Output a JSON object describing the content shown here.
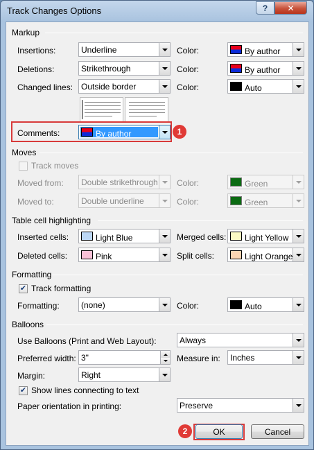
{
  "window": {
    "title": "Track Changes Options",
    "help_label": "?",
    "close_label": "✕"
  },
  "markup": {
    "section_label": "Markup",
    "insertions_label": "Insertions:",
    "insertions_value": "Underline",
    "insertions_color_label": "Color:",
    "insertions_color": "By author",
    "deletions_label": "Deletions:",
    "deletions_value": "Strikethrough",
    "deletions_color_label": "Color:",
    "deletions_color": "By author",
    "changed_lines_label": "Changed lines:",
    "changed_lines_value": "Outside border",
    "changed_lines_color_label": "Color:",
    "changed_lines_color": "Auto",
    "comments_label": "Comments:",
    "comments_color": "By author"
  },
  "moves": {
    "section_label": "Moves",
    "track_moves_label": "Track moves",
    "moved_from_label": "Moved from:",
    "moved_from_value": "Double strikethrough",
    "moved_from_color_label": "Color:",
    "moved_from_color": "Green",
    "moved_to_label": "Moved to:",
    "moved_to_value": "Double underline",
    "moved_to_color_label": "Color:",
    "moved_to_color": "Green"
  },
  "table_cells": {
    "section_label": "Table cell highlighting",
    "inserted_label": "Inserted cells:",
    "inserted_value": "Light Blue",
    "merged_label": "Merged cells:",
    "merged_value": "Light Yellow",
    "deleted_label": "Deleted cells:",
    "deleted_value": "Pink",
    "split_label": "Split cells:",
    "split_value": "Light Orange"
  },
  "formatting": {
    "section_label": "Formatting",
    "track_formatting_label": "Track formatting",
    "formatting_label": "Formatting:",
    "formatting_value": "(none)",
    "color_label": "Color:",
    "color_value": "Auto"
  },
  "balloons": {
    "section_label": "Balloons",
    "use_balloons_label": "Use Balloons (Print and Web Layout):",
    "use_balloons_value": "Always",
    "preferred_width_label": "Preferred width:",
    "preferred_width_value": "3\"",
    "measure_in_label": "Measure in:",
    "measure_in_value": "Inches",
    "margin_label": "Margin:",
    "margin_value": "Right",
    "show_lines_label": "Show lines connecting to text",
    "paper_orientation_label": "Paper orientation in printing:",
    "paper_orientation_value": "Preserve"
  },
  "buttons": {
    "ok_label": "OK",
    "cancel_label": "Cancel"
  },
  "annotations": {
    "badge_1": "1",
    "badge_2": "2"
  },
  "colors": {
    "green": "#0b6b12",
    "auto": "#000000",
    "light_blue": "#bcd7f5",
    "light_yellow": "#fbfac4",
    "pink": "#f8c0d6",
    "light_orange": "#fbd5b3",
    "highlight_red": "#d83a3a",
    "selection_blue": "#3399ff"
  }
}
